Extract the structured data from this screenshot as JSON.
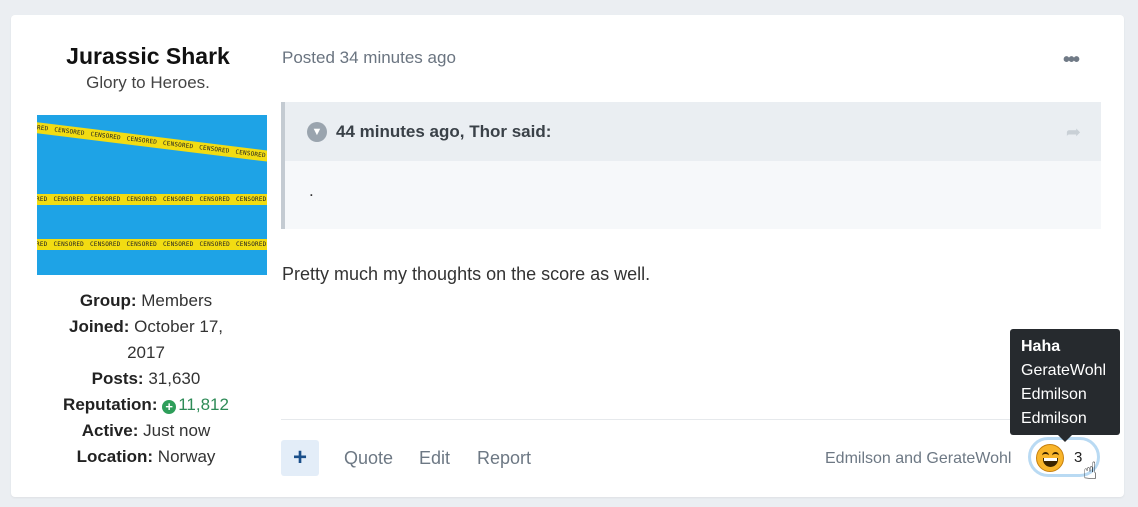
{
  "author": {
    "name": "Jurassic Shark",
    "title": "Glory to Heroes.",
    "avatar_tape_text": "CENSORED",
    "stats": [
      {
        "label": "Group:",
        "value": "Members"
      },
      {
        "label": "Joined:",
        "value": "October 17, 2017"
      },
      {
        "label": "Posts:",
        "value": "31,630"
      },
      {
        "label": "Reputation:",
        "value": "11,812"
      },
      {
        "label": "Active:",
        "value": "Just now"
      },
      {
        "label": "Location:",
        "value": "Norway"
      }
    ]
  },
  "post": {
    "posted": "Posted 34 minutes ago",
    "quote_header": "44 minutes ago, Thor said:",
    "quote_body": ".",
    "body": "Pretty much my thoughts on the score as well."
  },
  "footer": {
    "plus_label": "+",
    "controls": [
      "Quote",
      "Edit",
      "Report"
    ],
    "reacted_by": "Edmilson and GerateWohl",
    "reaction_count": "3"
  },
  "tooltip": {
    "title": "Haha",
    "names": [
      "GerateWohl",
      "Edmilson",
      "Edmilson"
    ]
  },
  "colors": {
    "reputation": "#2e8b57",
    "accent": "#1a4f8a",
    "avatar_bg": "#1ea3e6",
    "tape": "#f2dc12"
  }
}
